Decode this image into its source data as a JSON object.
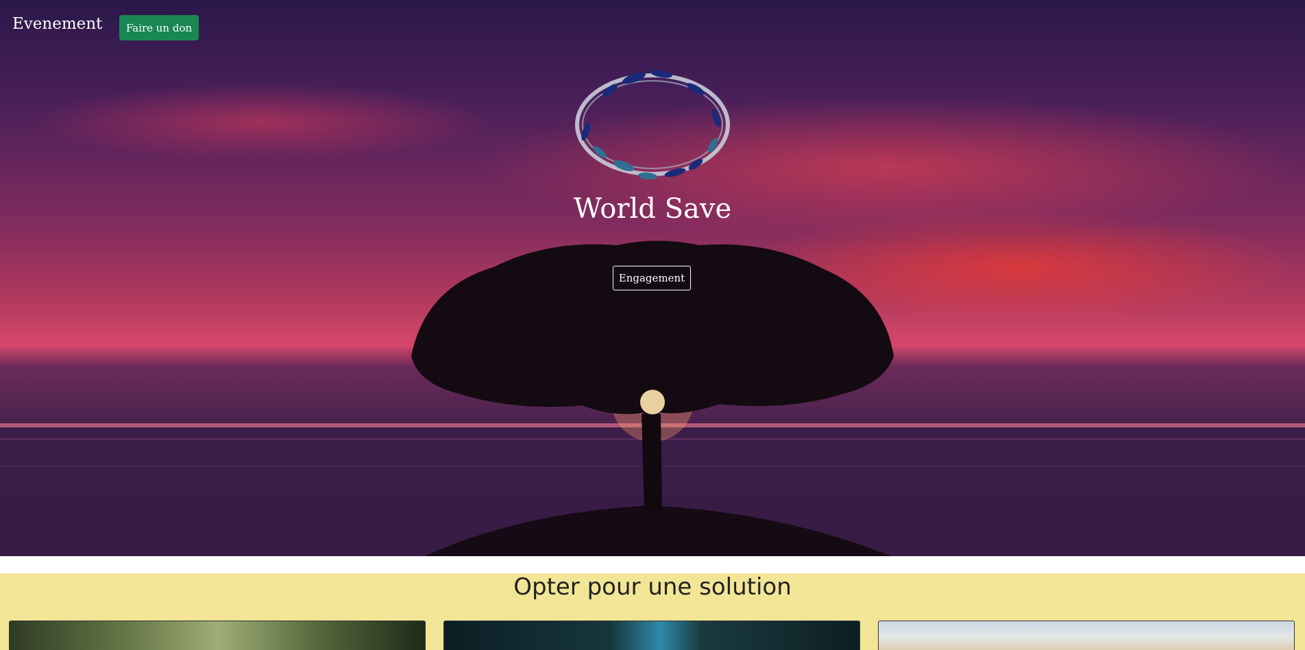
{
  "nav": {
    "brand": "Evenement",
    "donate_label": "Faire un don",
    "donate_color": "#198754"
  },
  "hero": {
    "logo_icon": "wreath-icon",
    "title": "World Save",
    "engage_label": "Engagement"
  },
  "solution": {
    "title": "Opter pour une solution",
    "background": "#f2e596",
    "cards": [
      {
        "image": "plants-photo"
      },
      {
        "image": "water-photo"
      },
      {
        "image": "sky-photo"
      }
    ]
  }
}
